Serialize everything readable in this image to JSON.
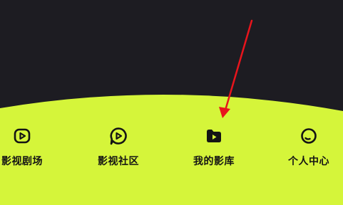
{
  "colors": {
    "top_background": "#1d1c22",
    "nav_background": "#d5f53a",
    "text": "#141414",
    "annotation_arrow": "#e8141c"
  },
  "bottom_nav": {
    "items": [
      {
        "label": "影视剧场",
        "icon": "play-video-icon",
        "selected": false
      },
      {
        "label": "影视社区",
        "icon": "chat-play-icon",
        "selected": false
      },
      {
        "label": "我的影库",
        "icon": "folder-play-icon",
        "selected": true
      },
      {
        "label": "个人中心",
        "icon": "profile-circle-icon",
        "selected": false
      }
    ]
  }
}
